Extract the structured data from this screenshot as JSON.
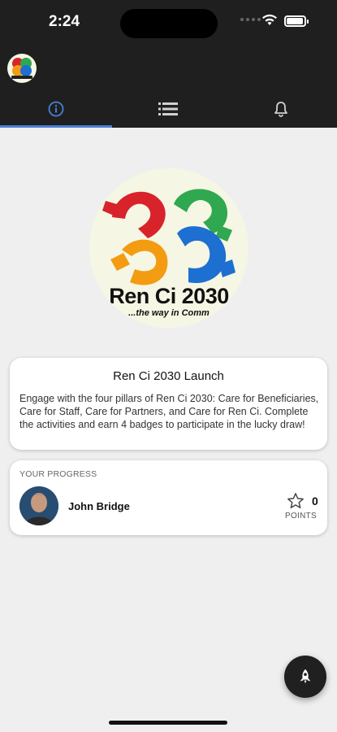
{
  "status_bar": {
    "time": "2:24"
  },
  "tabs": [
    {
      "icon": "info-icon",
      "active": true
    },
    {
      "icon": "list-icon",
      "active": false
    },
    {
      "icon": "bell-icon",
      "active": false
    }
  ],
  "hero": {
    "logo_text": "Ren Ci 2030",
    "logo_tagline": "...the way in Comm"
  },
  "info_card": {
    "title": "Ren Ci 2030 Launch",
    "body": "Engage with the four pillars of Ren Ci 2030: Care for Beneficiaries, Care for Staff, Care for Partners, and Care for Ren Ci. Complete the activities and earn 4 badges to participate in the lucky draw!"
  },
  "progress": {
    "label": "YOUR PROGRESS",
    "user_name": "John Bridge",
    "points": "0",
    "points_label": "POINTS"
  },
  "colors": {
    "accent": "#4a7fd6",
    "header_bg": "#1f1f1f",
    "page_bg": "#efefef",
    "logo_red": "#d8232a",
    "logo_orange": "#f39c12",
    "logo_green": "#2fa84f",
    "logo_blue": "#1d6fd1"
  },
  "fab": {
    "icon": "rocket-icon"
  }
}
